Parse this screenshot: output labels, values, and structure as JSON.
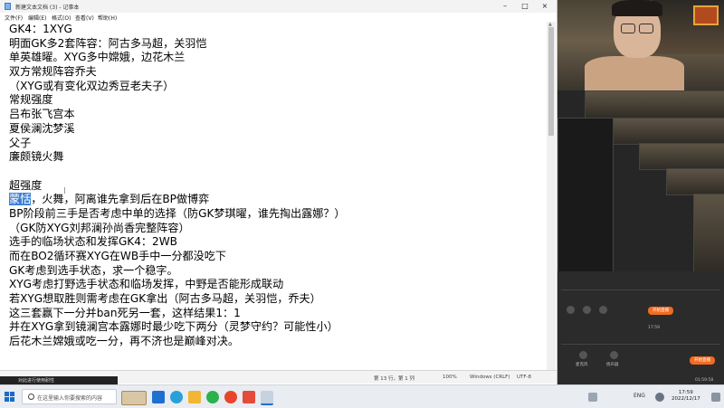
{
  "notepad": {
    "title": "新建文本文档 (3) - 记事本",
    "menu": [
      "文件(F)",
      "编辑(E)",
      "格式(O)",
      "查看(V)",
      "帮助(H)"
    ],
    "lines": [
      "GK4：1XYG",
      "明面GK多2套阵容：阿古多马超，关羽恺",
      "单英雄曜。XYG多中嫦娥，边花木兰",
      "双方常规阵容乔夫",
      "（XYG或有变化双边秀豆老夫子）",
      "常规强度",
      "吕布张飞宫本",
      "夏侯澜沈梦溪",
      "父子",
      "廉颇镜火舞",
      "",
      "超强度",
      "",
      "BP阶段前三手是否考虑中单的选择（防GK梦琪曜，谁先掏出露娜？）",
      "（GK防XYG刘邦澜孙尚香完整阵容）",
      "选手的临场状态和发挥GK4：2WB",
      "而在BO2循环赛XYG在WB手中一分都没吃下",
      "GK考虑到选手状态，求一个稳字。",
      "XYG考虑打野选手状态和临场发挥，中野是否能形成联动",
      "若XYG想取胜则需考虑在GK拿出（阿古多马超，关羽恺，乔夫）",
      "这三套赢下一分并ban死另一套，这样结果1：1",
      "并在XYG拿到镜澜宫本露娜时最少吃下两分（灵梦守约？可能性小）",
      "后花木兰嫦娥或吃一分，再不济也是巅峰对决。"
    ],
    "selected_line": {
      "selected": "蒙恬",
      "rest": "，火舞，阿离谁先拿到后在BP做博弈"
    },
    "status": {
      "position": "第 13 行，第 1 列",
      "zoom": "100%",
      "line_ending": "Windows (CRLF)",
      "encoding": "UTF-8"
    }
  },
  "taskbar": {
    "search_placeholder": "在这里输入你要搜索的内容",
    "overlay_text": "对此进行使用耐性",
    "tray_temp": "ENG",
    "clock_time": "17:59",
    "clock_date": "2022/12/17"
  },
  "stream": {
    "live_button": "开始直播",
    "labels": [
      "麦克风",
      "扬声器"
    ],
    "time": "01:59:58"
  },
  "colors": {
    "selection": "#3c7fd6",
    "live_orange": "#f26b21"
  }
}
